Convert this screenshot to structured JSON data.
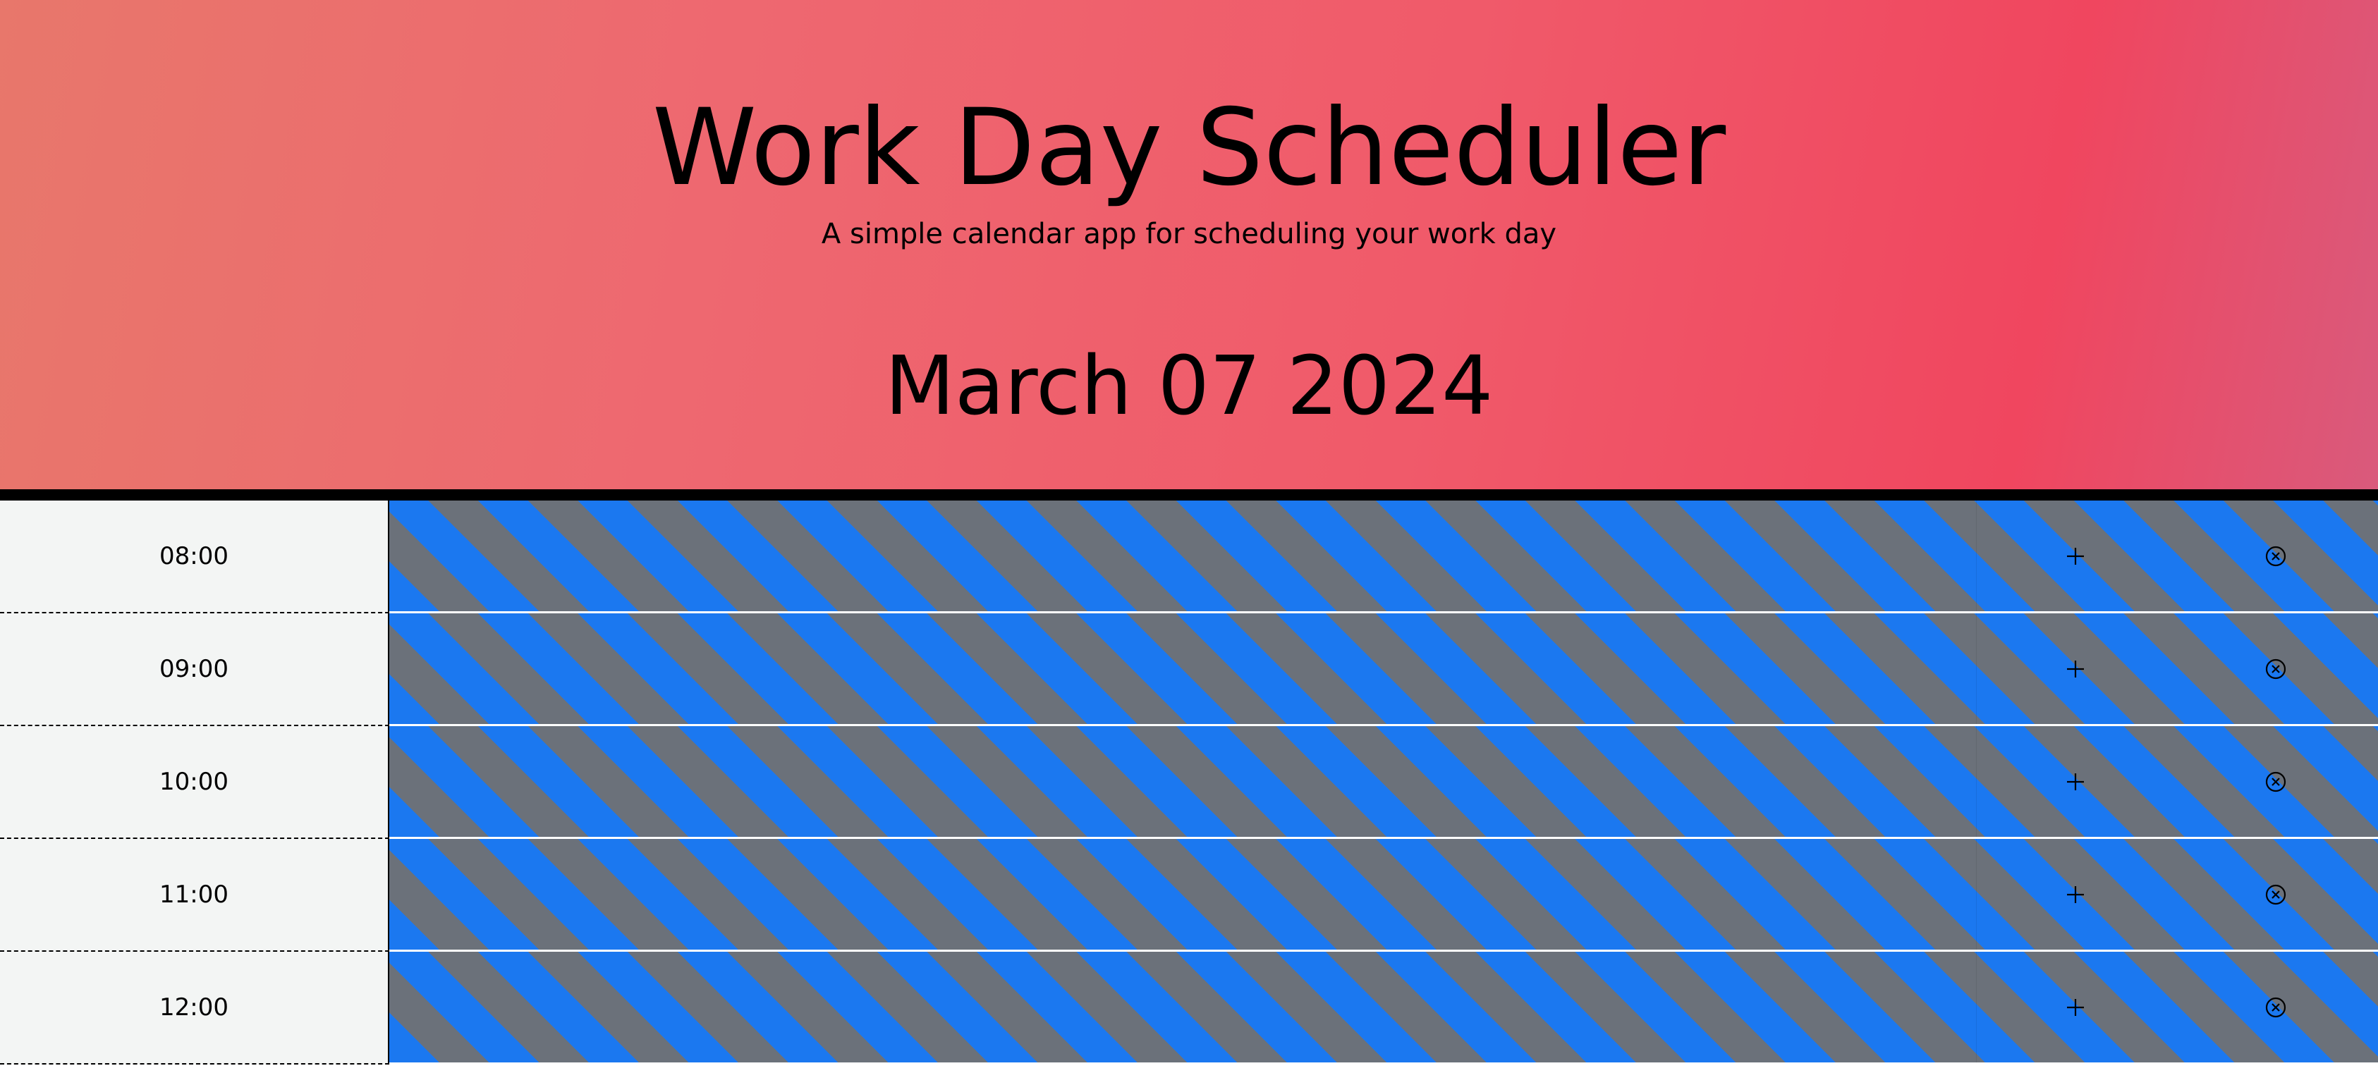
{
  "header": {
    "title": "Work Day Scheduler",
    "subtitle": "A simple calendar app for scheduling your work day",
    "date": "March 07 2024"
  },
  "icons": {
    "add": "plus-icon",
    "clear": "x-circle-icon"
  },
  "colors": {
    "header_gradient_start": "#e8776b",
    "header_gradient_end": "#f0465f",
    "slot_stripe_blue": "#1b78f0",
    "slot_stripe_gray": "#6b717a",
    "hour_background": "#f3f5f4"
  },
  "rows": [
    {
      "hour": "08:00",
      "event": ""
    },
    {
      "hour": "09:00",
      "event": ""
    },
    {
      "hour": "10:00",
      "event": ""
    },
    {
      "hour": "11:00",
      "event": ""
    },
    {
      "hour": "12:00",
      "event": ""
    }
  ]
}
